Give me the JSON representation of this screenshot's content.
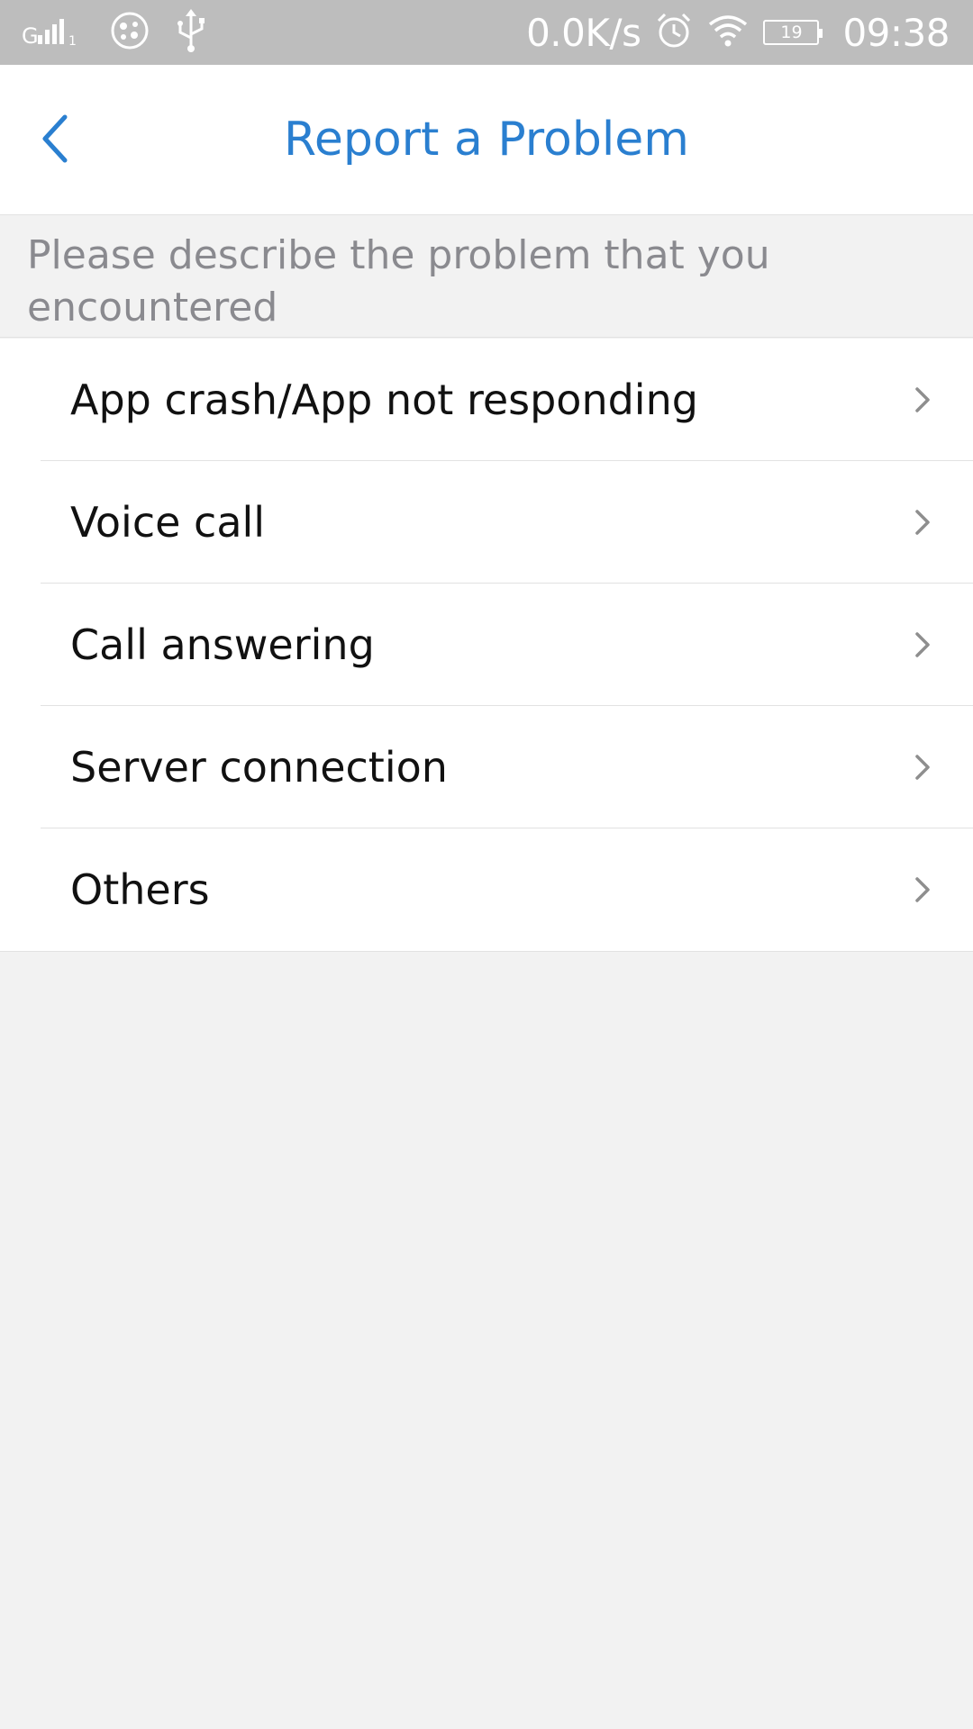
{
  "status_bar": {
    "network_speed": "0.0K/s",
    "battery_level": "19",
    "time": "09:38",
    "icons": [
      "signal-icon",
      "app-notification-icon",
      "usb-icon",
      "alarm-icon",
      "wifi-icon",
      "battery-icon"
    ]
  },
  "header": {
    "title": "Report a Problem",
    "back_icon": "chevron-left-icon"
  },
  "description": "Please describe the problem that you encountered",
  "problems": [
    {
      "label": "App crash/App not responding"
    },
    {
      "label": "Voice call"
    },
    {
      "label": "Call answering"
    },
    {
      "label": "Server connection"
    },
    {
      "label": "Others"
    }
  ],
  "colors": {
    "accent": "#2a7fd0",
    "status_bar": "#bdbdbd",
    "background": "#f2f2f2",
    "secondary_text": "#8a8a8f"
  }
}
